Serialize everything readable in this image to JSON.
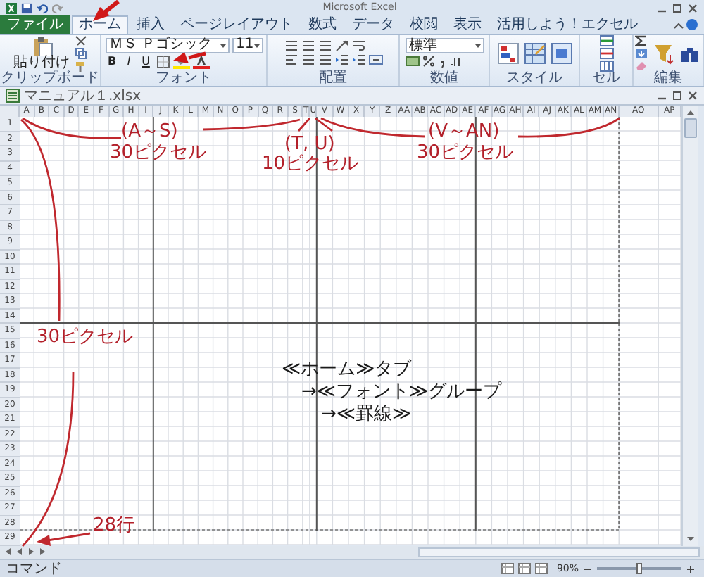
{
  "window": {
    "title": "Microsoft Excel"
  },
  "tabs": [
    {
      "label": "ファイル",
      "kind": "file",
      "selected": false
    },
    {
      "label": "ホーム",
      "kind": "tab",
      "selected": true
    },
    {
      "label": "挿入",
      "kind": "tab",
      "selected": false
    },
    {
      "label": "ページレイアウト",
      "kind": "tab",
      "selected": false
    },
    {
      "label": "数式",
      "kind": "tab",
      "selected": false
    },
    {
      "label": "データ",
      "kind": "tab",
      "selected": false
    },
    {
      "label": "校閲",
      "kind": "tab",
      "selected": false
    },
    {
      "label": "表示",
      "kind": "tab",
      "selected": false
    },
    {
      "label": "活用しよう！エクセル",
      "kind": "tab",
      "selected": false
    }
  ],
  "ribbon": {
    "groups": [
      {
        "kind": "clipboard",
        "label": "クリップボード",
        "button": "貼り付け"
      },
      {
        "kind": "font",
        "label": "フォント",
        "font_name": "ＭＳ Ｐゴシック",
        "font_size": "11",
        "format_buttons": [
          "B",
          "I",
          "U"
        ]
      },
      {
        "kind": "alignment",
        "label": "配置"
      },
      {
        "kind": "number",
        "label": "数値",
        "format": "標準"
      },
      {
        "kind": "styles",
        "label": "スタイル"
      },
      {
        "kind": "cells",
        "label": "セル"
      },
      {
        "kind": "editing",
        "label": "編集"
      }
    ]
  },
  "workbook": {
    "title": "マニュアル１.xlsx"
  },
  "sheet": {
    "columns": [
      "A",
      "B",
      "C",
      "D",
      "E",
      "F",
      "G",
      "H",
      "I",
      "J",
      "K",
      "L",
      "M",
      "N",
      "O",
      "P",
      "Q",
      "R",
      "S",
      "T",
      "U",
      "V",
      "W",
      "X",
      "Y",
      "Z",
      "AA",
      "AB",
      "AC",
      "AD",
      "AE",
      "AF",
      "AG",
      "AH",
      "AI",
      "AJ",
      "AK",
      "AL",
      "AM",
      "AN",
      "AO",
      "AP"
    ],
    "rows": [
      "1",
      "2",
      "3",
      "4",
      "5",
      "6",
      "7",
      "8",
      "9",
      "10",
      "11",
      "12",
      "13",
      "14",
      "15",
      "16",
      "17",
      "18",
      "19",
      "20",
      "21",
      "22",
      "23",
      "24",
      "25",
      "26",
      "27",
      "28",
      "29"
    ]
  },
  "annotations": {
    "labels": [
      "(A～S)",
      "30ピクセル",
      "(T, U)",
      "10ピクセル",
      "(V～AN)",
      "30ピクセル",
      "30ピクセル",
      "28行"
    ],
    "instructions": [
      "≪ホーム≫タブ",
      "→≪フォント≫グループ",
      "→≪罫線≫"
    ]
  },
  "status_bar": {
    "mode": "コマンド",
    "zoom": "90%",
    "zoom_slider": {
      "level": 0.5
    }
  }
}
